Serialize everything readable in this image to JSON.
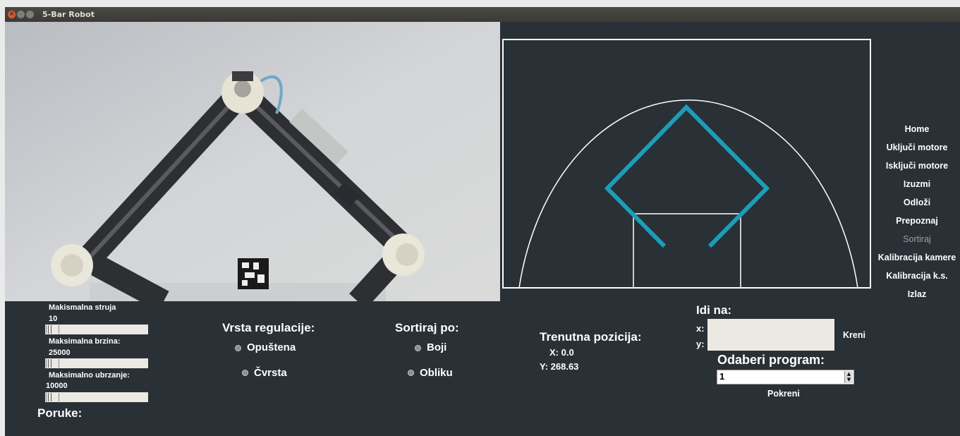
{
  "window": {
    "title": "5-Bar Robot"
  },
  "colors": {
    "background": "#293036",
    "arm": "#1c9db8",
    "outline": "#ffffff"
  },
  "menu": [
    {
      "label": "Home",
      "dim": false
    },
    {
      "label": "Uključi motore",
      "dim": false
    },
    {
      "label": "Isključi motore",
      "dim": false
    },
    {
      "label": "Izuzmi",
      "dim": false
    },
    {
      "label": "Odloži",
      "dim": false
    },
    {
      "label": "Prepoznaj",
      "dim": false
    },
    {
      "label": "Sortiraj",
      "dim": true
    },
    {
      "label": "Kalibracija kamere",
      "dim": false
    },
    {
      "label": "Kalibracija k.s.",
      "dim": false
    },
    {
      "label": "Izlaz",
      "dim": false
    }
  ],
  "sliders": {
    "current": {
      "label": "Makismalna struja",
      "value": "10"
    },
    "speed": {
      "label": "Maksimalna brzina:",
      "value": "25000"
    },
    "accel": {
      "label": "Maksimalno ubrzanje:",
      "value": "10000"
    }
  },
  "messages_label": "Poruke:",
  "regulation": {
    "title": "Vrsta regulacije:",
    "options": [
      "Opuštena",
      "Čvrsta"
    ]
  },
  "sort": {
    "title": "Sortiraj po:",
    "options": [
      "Boji",
      "Obliku"
    ]
  },
  "position": {
    "title": "Trenutna pozicija:",
    "x": "X: 0.0",
    "y": "Y: 268.63"
  },
  "goto": {
    "title": "Idi na:",
    "x_label": "x:",
    "y_label": "y:",
    "button": "Kreni"
  },
  "program": {
    "title": "Odaberi program:",
    "value": "1",
    "button": "Pokreni"
  },
  "camera": {
    "marker": "aruco-marker"
  }
}
